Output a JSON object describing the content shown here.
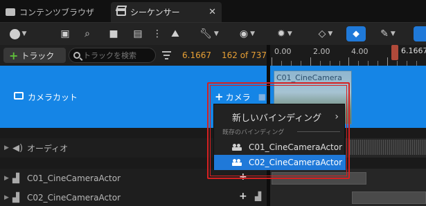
{
  "tabs": [
    {
      "label": "コンテンツブラウザ",
      "icon": "folder-icon"
    },
    {
      "label": "シーケンサー",
      "icon": "film-icon"
    }
  ],
  "header": {
    "add_track_label": "トラック",
    "search_placeholder": "トラックを検索",
    "current_time": "6.1667",
    "frame_counter": "162 of 737"
  },
  "ruler": {
    "labels": [
      "0.00",
      "2.00",
      "4.00"
    ],
    "playhead_time": "6.1667"
  },
  "tracks": {
    "camera_cut": {
      "label": "カメラカット",
      "add_camera_label": "カメラ",
      "clip_label": "C01_CineCamera"
    },
    "audio": {
      "label": "オーディオ"
    },
    "actor1": {
      "label": "C01_CineCameraActor"
    },
    "actor2": {
      "label": "C02_CineCameraActor"
    }
  },
  "menu": {
    "new_binding": "新しいバインディング",
    "existing_section": "既存のバインディング",
    "items": [
      "C01_CineCameraActor",
      "C02_CineCameraActor"
    ],
    "selected_index": 1
  },
  "colors": {
    "accent": "#1f79d9",
    "track_selected": "#1585e6",
    "time_text": "#e8a035",
    "highlight_border": "#d62020"
  }
}
